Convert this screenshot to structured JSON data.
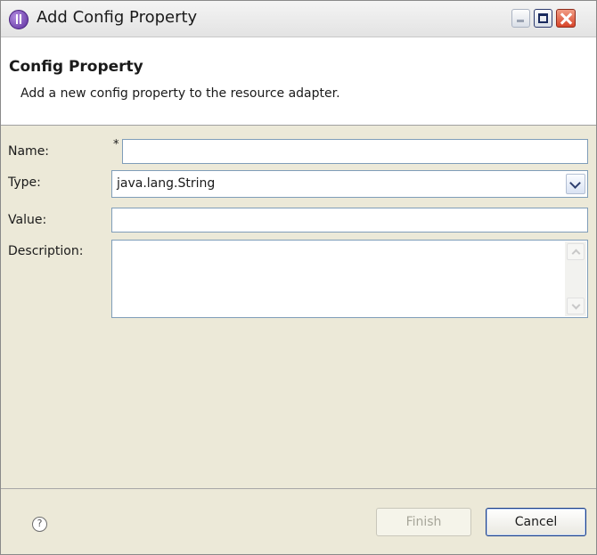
{
  "window": {
    "title": "Add Config Property"
  },
  "banner": {
    "title": "Config Property",
    "description": "Add a new config property to the resource adapter."
  },
  "form": {
    "name_label": "Name:",
    "required_marker": "*",
    "name_value": "",
    "type_label": "Type:",
    "type_value": "java.lang.String",
    "value_label": "Value:",
    "value_value": "",
    "description_label": "Description:",
    "description_value": ""
  },
  "footer": {
    "help_glyph": "?",
    "finish_label": "Finish",
    "cancel_label": "Cancel"
  }
}
